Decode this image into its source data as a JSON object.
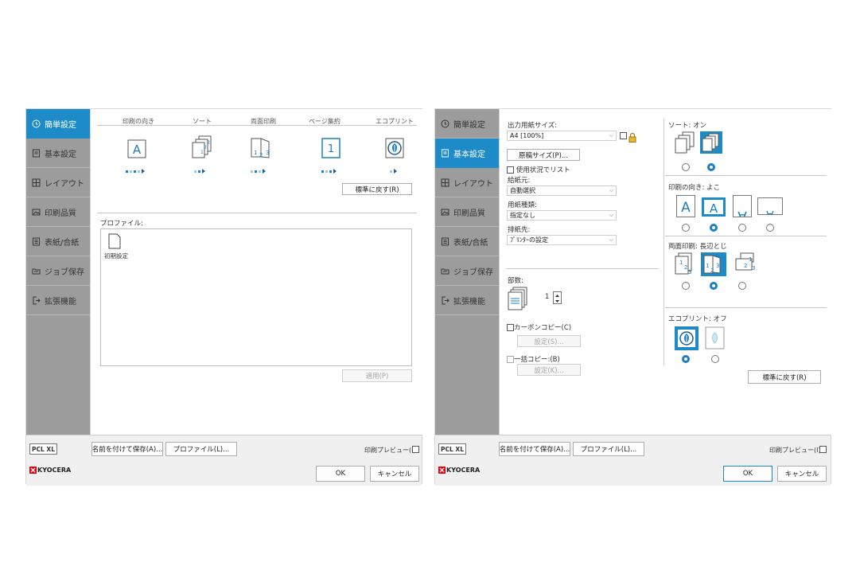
{
  "nav": {
    "items": [
      {
        "label": "簡単設定",
        "icon": "clock-icon"
      },
      {
        "label": "基本設定",
        "icon": "document-icon"
      },
      {
        "label": "レイアウト",
        "icon": "grid-icon"
      },
      {
        "label": "印刷品質",
        "icon": "image-icon"
      },
      {
        "label": "表紙/合紙",
        "icon": "pages-icon"
      },
      {
        "label": "ジョブ保存",
        "icon": "folder-icon"
      },
      {
        "label": "拡張機能",
        "icon": "extension-icon"
      }
    ]
  },
  "quick": {
    "headers": [
      "印刷の向き",
      "ソート",
      "両面印刷",
      "ページ集約",
      "エコプリント"
    ],
    "restore_label": "標準に戻す(R)",
    "profile_label": "プロファイル:",
    "profile_item_label": "初期設定",
    "apply_label": "適用(P)"
  },
  "basic": {
    "output_size_label": "出力用紙サイズ:",
    "output_size_value": "A4 [100%]",
    "original_size_label": "原稿サイズ(P)...",
    "use_list_label": "使用状況でリスト",
    "source_label": "給紙元:",
    "source_value": "自動選択",
    "media_type_label": "用紙種類:",
    "media_type_value": "指定なし",
    "output_label": "排紙先:",
    "output_value": "ﾌﾟﾘﾝﾀｰの設定",
    "copies_label": "部数:",
    "copies_value": "1",
    "carbon_label": "カーボンコピー(C)",
    "carbon_settings_label": "設定(S)...",
    "batch_label": "一括コピー:(B)",
    "batch_settings_label": "設定(K)...",
    "sort_label": "ソート: オン",
    "orient_label": "印刷の向き: よこ",
    "duplex_label": "両面印刷: 長辺とじ",
    "eco_label": "エコプリント: オフ",
    "restore_label": "標準に戻す(R)"
  },
  "footer": {
    "pcl_label": "PCL XL",
    "save_as_label": "名前を付けて保存(A)...",
    "profile_label": "プロファイル(L)...",
    "preview_label": "印刷プレビュー(I)",
    "logo_text": "KYOCERA",
    "ok_label": "OK",
    "cancel_label": "キャンセル"
  },
  "colors": {
    "accent": "#1d8bc8",
    "sidebar": "#9c9c9c",
    "logo": "#e60012"
  }
}
